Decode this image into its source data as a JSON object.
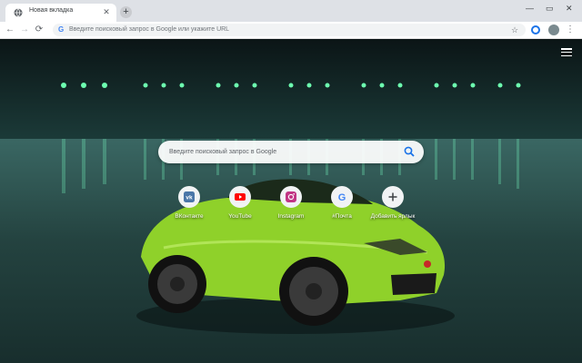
{
  "tab": {
    "title": "Новая вкладка"
  },
  "omnibox": {
    "placeholder": "Введите поисковый запрос в Google или укажите URL"
  },
  "search": {
    "placeholder": "Введите поисковый запрос в Google"
  },
  "shortcuts": [
    {
      "label": "ВКонтакте",
      "icon": "vk-icon",
      "color": "#4a76a8"
    },
    {
      "label": "YouTube",
      "icon": "youtube-icon",
      "color": "#ff0000"
    },
    {
      "label": "Instagram",
      "icon": "instagram-icon",
      "color": "#c13584"
    },
    {
      "label": "#Почта",
      "icon": "google-icon",
      "color": "#4285f4"
    },
    {
      "label": "Добавить ярлык",
      "icon": "plus-icon",
      "color": "#3c4043"
    }
  ],
  "colors": {
    "accent": "#1a73e8",
    "car": "#8fd12a"
  }
}
